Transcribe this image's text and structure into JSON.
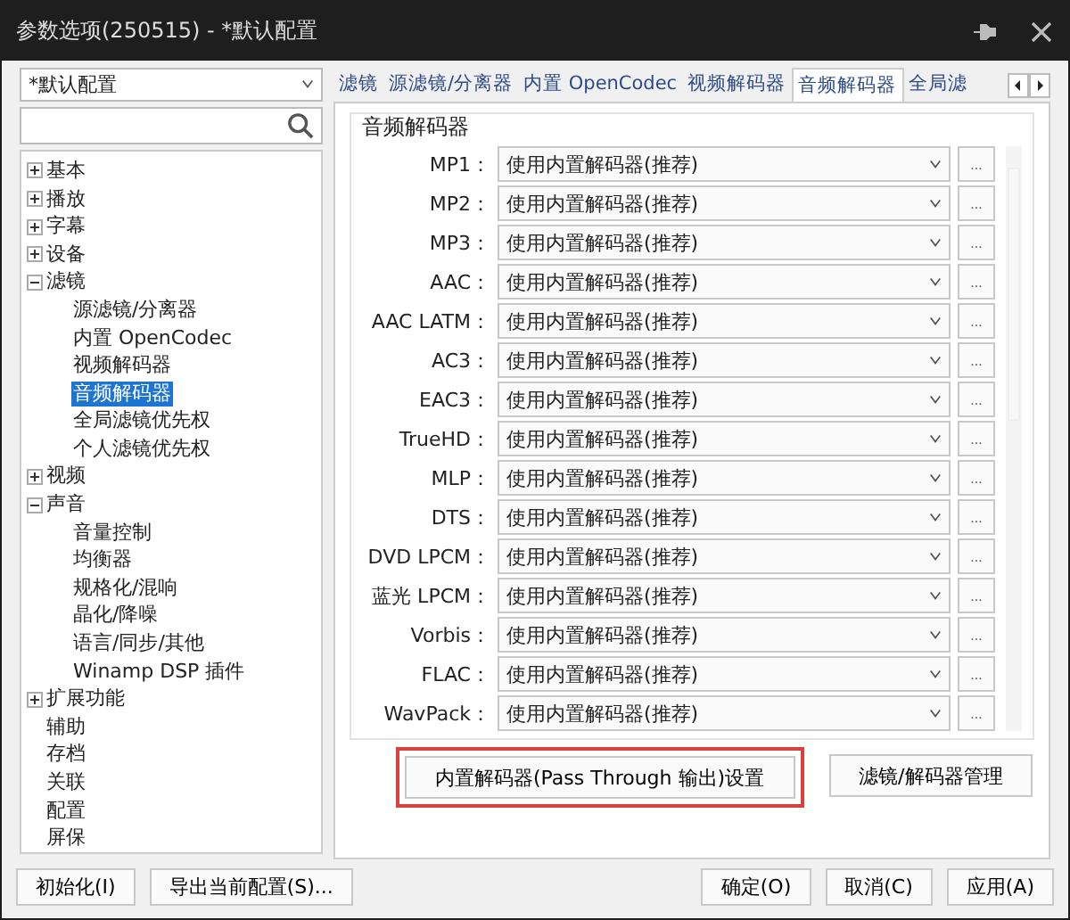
{
  "window": {
    "title": "参数选项(250515) - *默认配置"
  },
  "profile_select": {
    "value": "*默认配置"
  },
  "tree": [
    {
      "label": "基本",
      "expanded": false,
      "selected": false
    },
    {
      "label": "播放",
      "expanded": false,
      "selected": false
    },
    {
      "label": "字幕",
      "expanded": false,
      "selected": false
    },
    {
      "label": "设备",
      "expanded": false,
      "selected": false
    },
    {
      "label": "滤镜",
      "expanded": true,
      "selected": false,
      "children": [
        {
          "label": "源滤镜/分离器",
          "selected": false
        },
        {
          "label": "内置 OpenCodec",
          "selected": false
        },
        {
          "label": "视频解码器",
          "selected": false
        },
        {
          "label": "音频解码器",
          "selected": true
        },
        {
          "label": "全局滤镜优先权",
          "selected": false
        },
        {
          "label": "个人滤镜优先权",
          "selected": false
        }
      ]
    },
    {
      "label": "视频",
      "expanded": false,
      "selected": false
    },
    {
      "label": "声音",
      "expanded": true,
      "selected": false,
      "children": [
        {
          "label": "音量控制",
          "selected": false
        },
        {
          "label": "均衡器",
          "selected": false
        },
        {
          "label": "规格化/混响",
          "selected": false
        },
        {
          "label": "晶化/降噪",
          "selected": false
        },
        {
          "label": "语言/同步/其他",
          "selected": false
        },
        {
          "label": "Winamp DSP 插件",
          "selected": false
        }
      ]
    },
    {
      "label": "扩展功能",
      "expanded": false,
      "selected": false
    },
    {
      "label": "辅助",
      "selected": false
    },
    {
      "label": "存档",
      "selected": false
    },
    {
      "label": "关联",
      "selected": false
    },
    {
      "label": "配置",
      "selected": false
    },
    {
      "label": "屏保",
      "selected": false
    }
  ],
  "tabs": [
    {
      "label": "滤镜",
      "selected": false
    },
    {
      "label": "源滤镜/分离器",
      "selected": false
    },
    {
      "label": "内置 OpenCodec",
      "selected": false
    },
    {
      "label": "视频解码器",
      "selected": false
    },
    {
      "label": "音频解码器",
      "selected": true
    },
    {
      "label": "全局滤",
      "selected": false
    }
  ],
  "group": {
    "title": "音频解码器",
    "rows": [
      {
        "label": "MP1：",
        "value": "使用内置解码器(推荐)"
      },
      {
        "label": "MP2：",
        "value": "使用内置解码器(推荐)"
      },
      {
        "label": "MP3：",
        "value": "使用内置解码器(推荐)"
      },
      {
        "label": "AAC：",
        "value": "使用内置解码器(推荐)"
      },
      {
        "label": "AAC LATM：",
        "value": "使用内置解码器(推荐)"
      },
      {
        "label": "AC3：",
        "value": "使用内置解码器(推荐)"
      },
      {
        "label": "EAC3：",
        "value": "使用内置解码器(推荐)"
      },
      {
        "label": "TrueHD：",
        "value": "使用内置解码器(推荐)"
      },
      {
        "label": "MLP：",
        "value": "使用内置解码器(推荐)"
      },
      {
        "label": "DTS：",
        "value": "使用内置解码器(推荐)"
      },
      {
        "label": "DVD LPCM：",
        "value": "使用内置解码器(推荐)"
      },
      {
        "label": "蓝光 LPCM：",
        "value": "使用内置解码器(推荐)"
      },
      {
        "label": "Vorbis：",
        "value": "使用内置解码器(推荐)"
      },
      {
        "label": "FLAC：",
        "value": "使用内置解码器(推荐)"
      },
      {
        "label": "WavPack：",
        "value": "使用内置解码器(推荐)"
      }
    ],
    "more_button": "...",
    "buttons": [
      {
        "label": "内置解码器(Pass Through 输出)设置",
        "highlighted": true
      },
      {
        "label": "滤镜/解码器管理",
        "highlighted": false
      }
    ]
  },
  "footer": {
    "left_buttons": [
      "初始化(I)",
      "导出当前配置(S)..."
    ],
    "right_buttons": [
      "确定(O)",
      "取消(C)",
      "应用(A)"
    ]
  }
}
